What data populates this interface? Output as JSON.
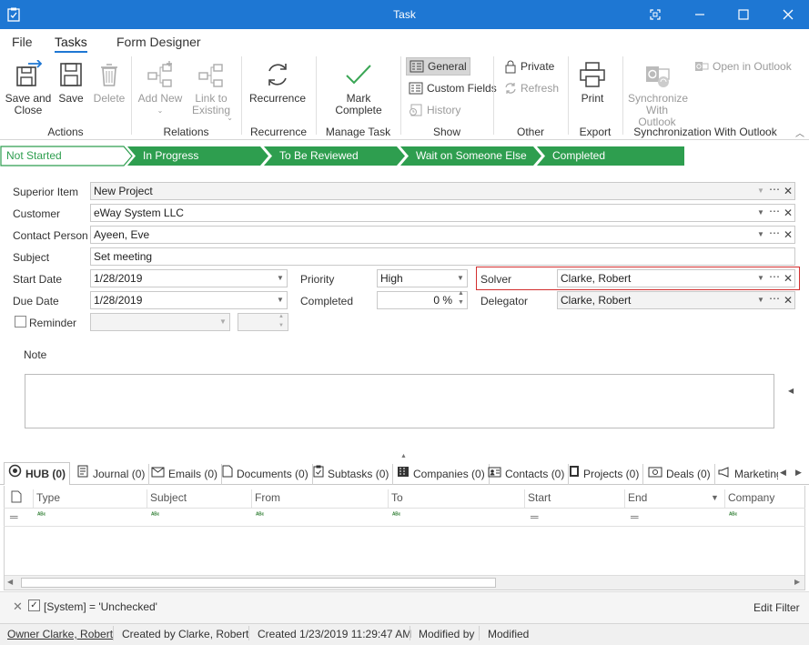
{
  "window": {
    "title": "Task"
  },
  "menu": {
    "file": "File",
    "tasks": "Tasks",
    "form_designer": "Form Designer"
  },
  "ribbon": {
    "save_and_close": "Save and\nClose",
    "save": "Save",
    "delete": "Delete",
    "add_new": "Add New",
    "link_to_existing": "Link to\nExisting",
    "recurrence": "Recurrence",
    "mark_complete": "Mark Complete",
    "general": "General",
    "custom_fields": "Custom Fields",
    "history": "History",
    "private": "Private",
    "refresh": "Refresh",
    "print": "Print",
    "synchronize_with_outlook": "Synchronize\nWith Outlook",
    "open_in_outlook": "Open in Outlook",
    "groups": {
      "actions": "Actions",
      "relations": "Relations",
      "recurrence": "Recurrence",
      "manage_task": "Manage Task",
      "show": "Show",
      "other": "Other",
      "export": "Export",
      "sync": "Synchronization With Outlook"
    }
  },
  "stages": [
    "Not Started",
    "In Progress",
    "To Be Reviewed",
    "Wait on Someone Else",
    "Completed"
  ],
  "form": {
    "superior_item_label": "Superior Item",
    "superior_item_value": "New Project",
    "customer_label": "Customer",
    "customer_value": "eWay System LLC",
    "contact_person_label": "Contact Person",
    "contact_person_value": "Ayeen, Eve",
    "subject_label": "Subject",
    "subject_value": "Set meeting",
    "start_date_label": "Start Date",
    "start_date_value": "1/28/2019",
    "due_date_label": "Due Date",
    "due_date_value": "1/28/2019",
    "priority_label": "Priority",
    "priority_value": "High",
    "completed_label": "Completed",
    "completed_value": "0 %",
    "solver_label": "Solver",
    "solver_value": "Clarke, Robert",
    "delegator_label": "Delegator",
    "delegator_value": "Clarke, Robert",
    "reminder_label": "Reminder",
    "note_label": "Note"
  },
  "tabs": [
    "HUB (0)",
    "Journal (0)",
    "Emails (0)",
    "Documents (0)",
    "Subtasks (0)",
    "Companies (0)",
    "Contacts (0)",
    "Projects (0)",
    "Deals (0)",
    "Marketing"
  ],
  "grid": {
    "columns": [
      "Type",
      "Subject",
      "From",
      "To",
      "Start",
      "End",
      "Company"
    ],
    "filter_text": "[System] = 'Unchecked'",
    "edit_filter": "Edit Filter"
  },
  "statusbar": {
    "owner": "Owner Clarke, Robert",
    "created_by": "Created by Clarke, Robert",
    "created": "Created 1/23/2019 11:29:47 AM",
    "modified_by": "Modified by",
    "modified": "Modified"
  },
  "colors": {
    "title_bar": "#1e77d3",
    "stage_green": "#2e9e4f",
    "solver_highlight": "#d32f2f"
  }
}
